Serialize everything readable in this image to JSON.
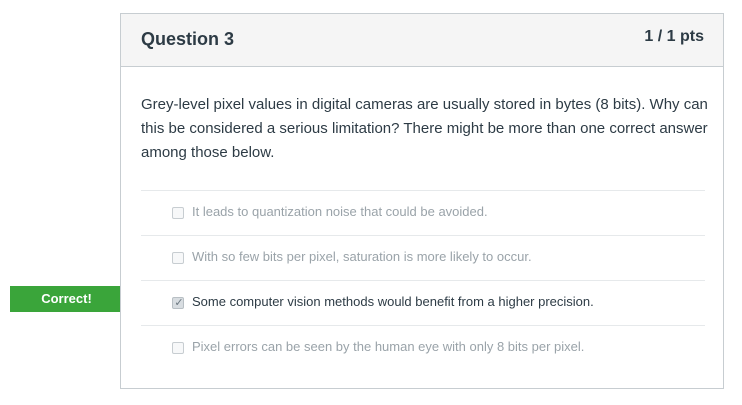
{
  "question": {
    "title": "Question 3",
    "points": "1 / 1 pts",
    "text": "Grey-level pixel values in digital cameras are usually stored in bytes (8 bits). Why can this be considered a serious limitation? There might be more than one correct answer among those below."
  },
  "answers": [
    {
      "label": "It leads to quantization noise that could be avoided.",
      "checked": false
    },
    {
      "label": "With so few bits per pixel, saturation is more likely to occur.",
      "checked": false
    },
    {
      "label": "Some computer vision methods would benefit from a higher precision.",
      "checked": true
    },
    {
      "label": "Pixel errors can be seen by the human eye with only 8 bits per pixel.",
      "checked": false
    }
  ],
  "feedback": {
    "correct_label": "Correct!",
    "accent_color": "#3aa53a"
  }
}
